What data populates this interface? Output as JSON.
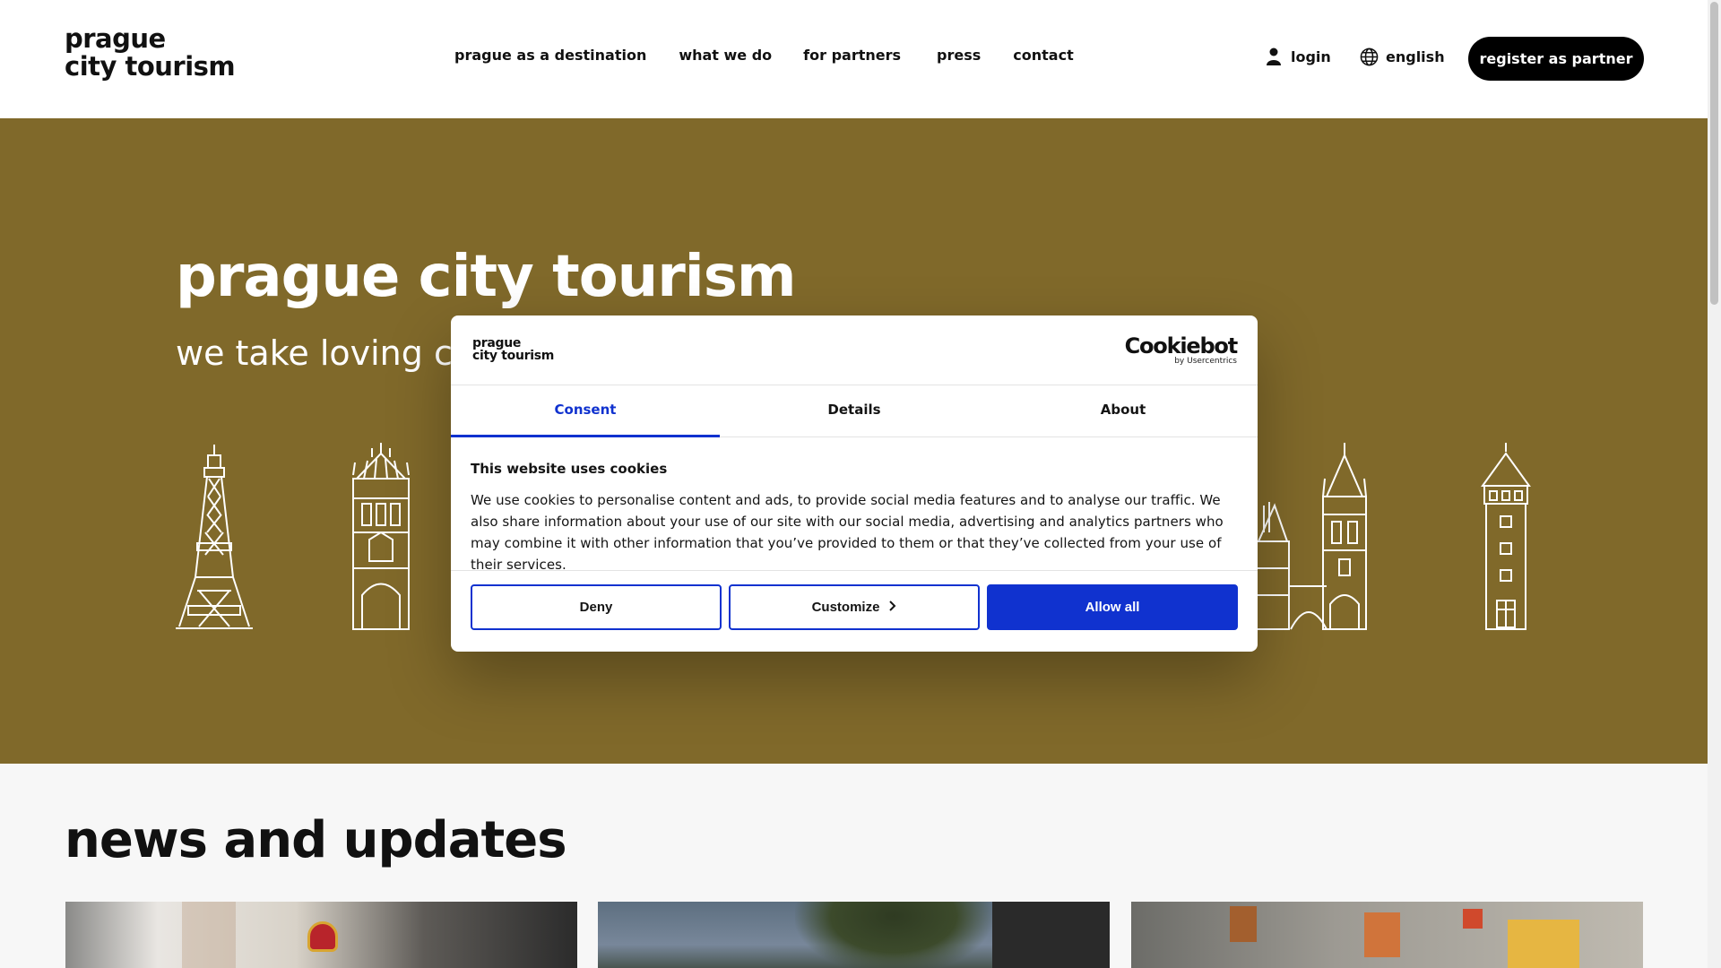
{
  "header": {
    "logo_line1": "prague",
    "logo_line2": "city tourism",
    "nav": [
      "prague as a destination",
      "what we do",
      "for partners",
      "press",
      "contact"
    ],
    "login_label": "login",
    "language_label": "english",
    "register_label": "register as partner"
  },
  "hero": {
    "title": "prague city tourism",
    "subtitle": "we take loving care of prague",
    "background_color": "#80692a"
  },
  "news": {
    "title": "news and updates"
  },
  "cookie_dialog": {
    "logo_line1": "prague",
    "logo_line2": "city tourism",
    "brand": "Cookiebot",
    "brand_sub": "by Usercentrics",
    "tabs": [
      "Consent",
      "Details",
      "About"
    ],
    "active_tab": "Consent",
    "heading": "This website uses cookies",
    "text": "We use cookies to personalise content and ads, to provide social media features and to analyse our traffic. We also share information about your use of our site with our social media, advertising and analytics partners who may combine it with other information that you’ve provided to them or that they’ve collected from your use of their services.",
    "buttons": {
      "deny": "Deny",
      "customize": "Customize",
      "allow_all": "Allow all"
    },
    "accent_color": "#1032cf"
  },
  "icons": {
    "login": "user-icon",
    "language": "globe-icon",
    "customize": "chevron-right-icon"
  }
}
